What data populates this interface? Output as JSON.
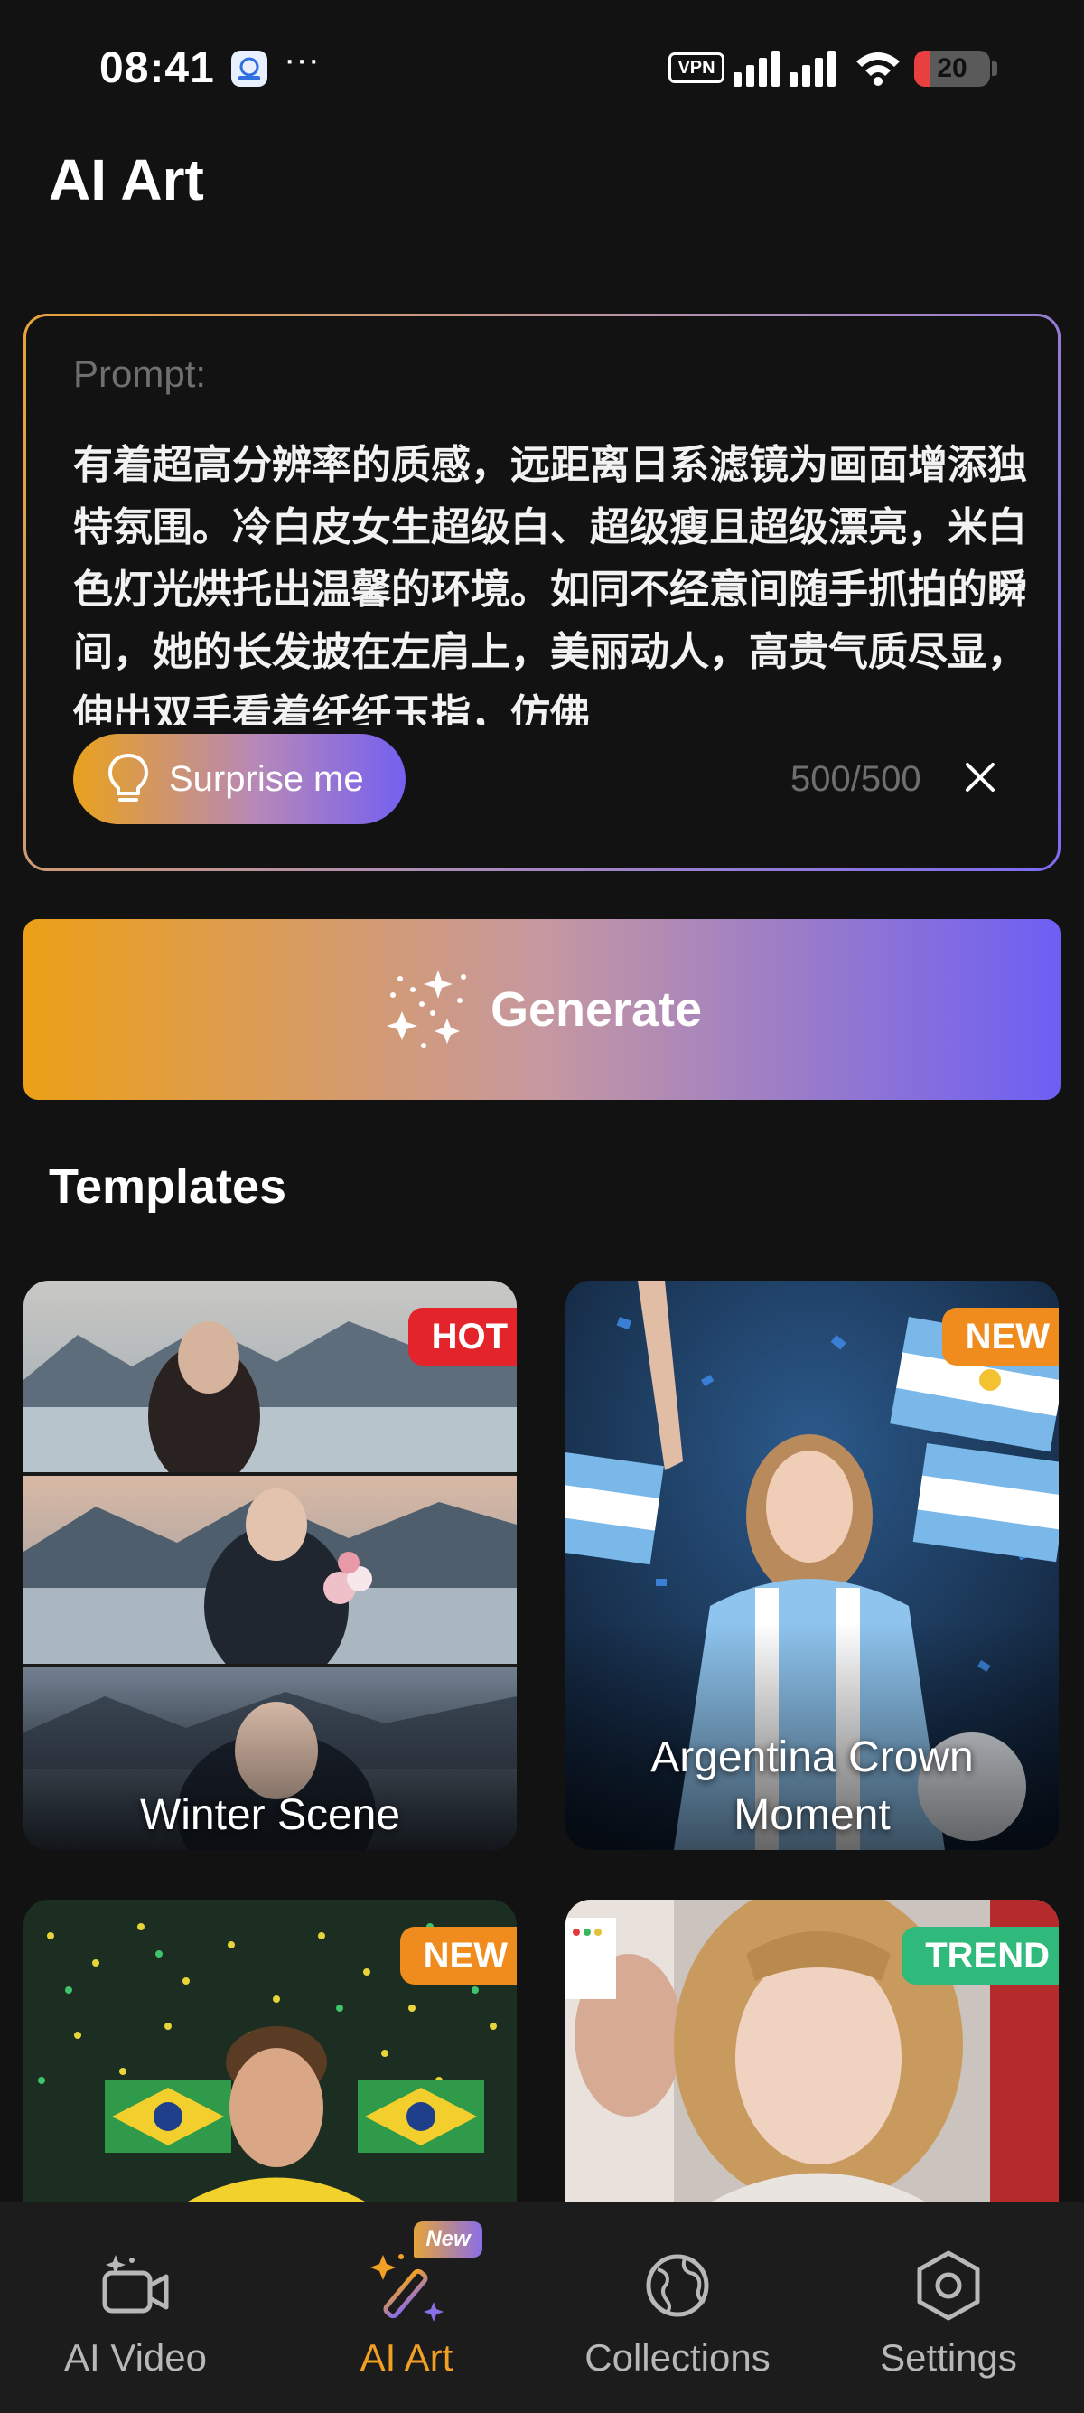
{
  "status_bar": {
    "time": "08:41",
    "more": "···",
    "vpn": "VPN",
    "battery": "20",
    "battery_level": 0.2
  },
  "header": {
    "title": "AI Art"
  },
  "prompt": {
    "label": "Prompt:",
    "text": "有着超高分辨率的质感，远距离日系滤镜为画面增添独特氛围。冷白皮女生超级白、超级瘦且超级漂亮，米白色灯光烘托出温馨的环境。如同不经意间随手抓拍的瞬间，她的长发披在左肩上，美丽动人，高贵气质尽显，伸出双手看着纤纤玉指，仿佛",
    "surprise_label": "Surprise me",
    "char_count": "500/500"
  },
  "generate": {
    "label": "Generate"
  },
  "templates": {
    "title": "Templates",
    "items": [
      {
        "title": "Winter Scene",
        "badge": "HOT",
        "badge_color": "#e3242b"
      },
      {
        "title": "Argentina Crown Moment",
        "badge": "NEW",
        "badge_color": "#f08c1e"
      },
      {
        "title": "",
        "badge": "NEW",
        "badge_color": "#f08c1e"
      },
      {
        "title": "",
        "badge": "TREND",
        "badge_color": "#2fb97a"
      }
    ]
  },
  "bottom_nav": {
    "items": [
      {
        "label": "AI Video",
        "icon": "video-camera-icon",
        "active": false
      },
      {
        "label": "AI Art",
        "icon": "magic-wand-icon",
        "active": true,
        "badge": "New"
      },
      {
        "label": "Collections",
        "icon": "globe-icon",
        "active": false
      },
      {
        "label": "Settings",
        "icon": "hexagon-settings-icon",
        "active": false
      }
    ]
  },
  "colors": {
    "background": "#121212",
    "accent_orange": "#f2a024",
    "accent_purple": "#7560f0",
    "nav_background": "#1c1c1c"
  }
}
